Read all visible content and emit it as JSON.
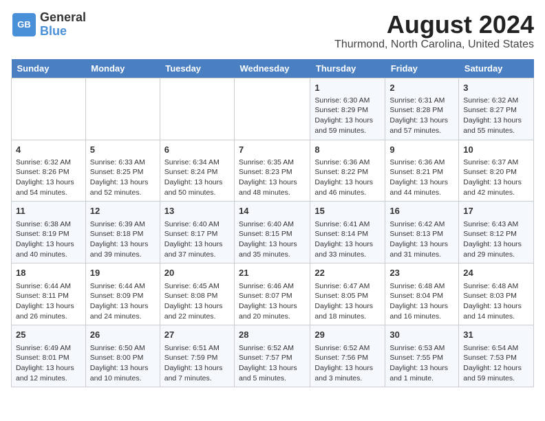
{
  "header": {
    "logo_general": "General",
    "logo_blue": "Blue",
    "title": "August 2024",
    "subtitle": "Thurmond, North Carolina, United States"
  },
  "weekdays": [
    "Sunday",
    "Monday",
    "Tuesday",
    "Wednesday",
    "Thursday",
    "Friday",
    "Saturday"
  ],
  "weeks": [
    [
      {
        "day": "",
        "info": ""
      },
      {
        "day": "",
        "info": ""
      },
      {
        "day": "",
        "info": ""
      },
      {
        "day": "",
        "info": ""
      },
      {
        "day": "1",
        "info": "Sunrise: 6:30 AM\nSunset: 8:29 PM\nDaylight: 13 hours\nand 59 minutes."
      },
      {
        "day": "2",
        "info": "Sunrise: 6:31 AM\nSunset: 8:28 PM\nDaylight: 13 hours\nand 57 minutes."
      },
      {
        "day": "3",
        "info": "Sunrise: 6:32 AM\nSunset: 8:27 PM\nDaylight: 13 hours\nand 55 minutes."
      }
    ],
    [
      {
        "day": "4",
        "info": "Sunrise: 6:32 AM\nSunset: 8:26 PM\nDaylight: 13 hours\nand 54 minutes."
      },
      {
        "day": "5",
        "info": "Sunrise: 6:33 AM\nSunset: 8:25 PM\nDaylight: 13 hours\nand 52 minutes."
      },
      {
        "day": "6",
        "info": "Sunrise: 6:34 AM\nSunset: 8:24 PM\nDaylight: 13 hours\nand 50 minutes."
      },
      {
        "day": "7",
        "info": "Sunrise: 6:35 AM\nSunset: 8:23 PM\nDaylight: 13 hours\nand 48 minutes."
      },
      {
        "day": "8",
        "info": "Sunrise: 6:36 AM\nSunset: 8:22 PM\nDaylight: 13 hours\nand 46 minutes."
      },
      {
        "day": "9",
        "info": "Sunrise: 6:36 AM\nSunset: 8:21 PM\nDaylight: 13 hours\nand 44 minutes."
      },
      {
        "day": "10",
        "info": "Sunrise: 6:37 AM\nSunset: 8:20 PM\nDaylight: 13 hours\nand 42 minutes."
      }
    ],
    [
      {
        "day": "11",
        "info": "Sunrise: 6:38 AM\nSunset: 8:19 PM\nDaylight: 13 hours\nand 40 minutes."
      },
      {
        "day": "12",
        "info": "Sunrise: 6:39 AM\nSunset: 8:18 PM\nDaylight: 13 hours\nand 39 minutes."
      },
      {
        "day": "13",
        "info": "Sunrise: 6:40 AM\nSunset: 8:17 PM\nDaylight: 13 hours\nand 37 minutes."
      },
      {
        "day": "14",
        "info": "Sunrise: 6:40 AM\nSunset: 8:15 PM\nDaylight: 13 hours\nand 35 minutes."
      },
      {
        "day": "15",
        "info": "Sunrise: 6:41 AM\nSunset: 8:14 PM\nDaylight: 13 hours\nand 33 minutes."
      },
      {
        "day": "16",
        "info": "Sunrise: 6:42 AM\nSunset: 8:13 PM\nDaylight: 13 hours\nand 31 minutes."
      },
      {
        "day": "17",
        "info": "Sunrise: 6:43 AM\nSunset: 8:12 PM\nDaylight: 13 hours\nand 29 minutes."
      }
    ],
    [
      {
        "day": "18",
        "info": "Sunrise: 6:44 AM\nSunset: 8:11 PM\nDaylight: 13 hours\nand 26 minutes."
      },
      {
        "day": "19",
        "info": "Sunrise: 6:44 AM\nSunset: 8:09 PM\nDaylight: 13 hours\nand 24 minutes."
      },
      {
        "day": "20",
        "info": "Sunrise: 6:45 AM\nSunset: 8:08 PM\nDaylight: 13 hours\nand 22 minutes."
      },
      {
        "day": "21",
        "info": "Sunrise: 6:46 AM\nSunset: 8:07 PM\nDaylight: 13 hours\nand 20 minutes."
      },
      {
        "day": "22",
        "info": "Sunrise: 6:47 AM\nSunset: 8:05 PM\nDaylight: 13 hours\nand 18 minutes."
      },
      {
        "day": "23",
        "info": "Sunrise: 6:48 AM\nSunset: 8:04 PM\nDaylight: 13 hours\nand 16 minutes."
      },
      {
        "day": "24",
        "info": "Sunrise: 6:48 AM\nSunset: 8:03 PM\nDaylight: 13 hours\nand 14 minutes."
      }
    ],
    [
      {
        "day": "25",
        "info": "Sunrise: 6:49 AM\nSunset: 8:01 PM\nDaylight: 13 hours\nand 12 minutes."
      },
      {
        "day": "26",
        "info": "Sunrise: 6:50 AM\nSunset: 8:00 PM\nDaylight: 13 hours\nand 10 minutes."
      },
      {
        "day": "27",
        "info": "Sunrise: 6:51 AM\nSunset: 7:59 PM\nDaylight: 13 hours\nand 7 minutes."
      },
      {
        "day": "28",
        "info": "Sunrise: 6:52 AM\nSunset: 7:57 PM\nDaylight: 13 hours\nand 5 minutes."
      },
      {
        "day": "29",
        "info": "Sunrise: 6:52 AM\nSunset: 7:56 PM\nDaylight: 13 hours\nand 3 minutes."
      },
      {
        "day": "30",
        "info": "Sunrise: 6:53 AM\nSunset: 7:55 PM\nDaylight: 13 hours\nand 1 minute."
      },
      {
        "day": "31",
        "info": "Sunrise: 6:54 AM\nSunset: 7:53 PM\nDaylight: 12 hours\nand 59 minutes."
      }
    ]
  ]
}
